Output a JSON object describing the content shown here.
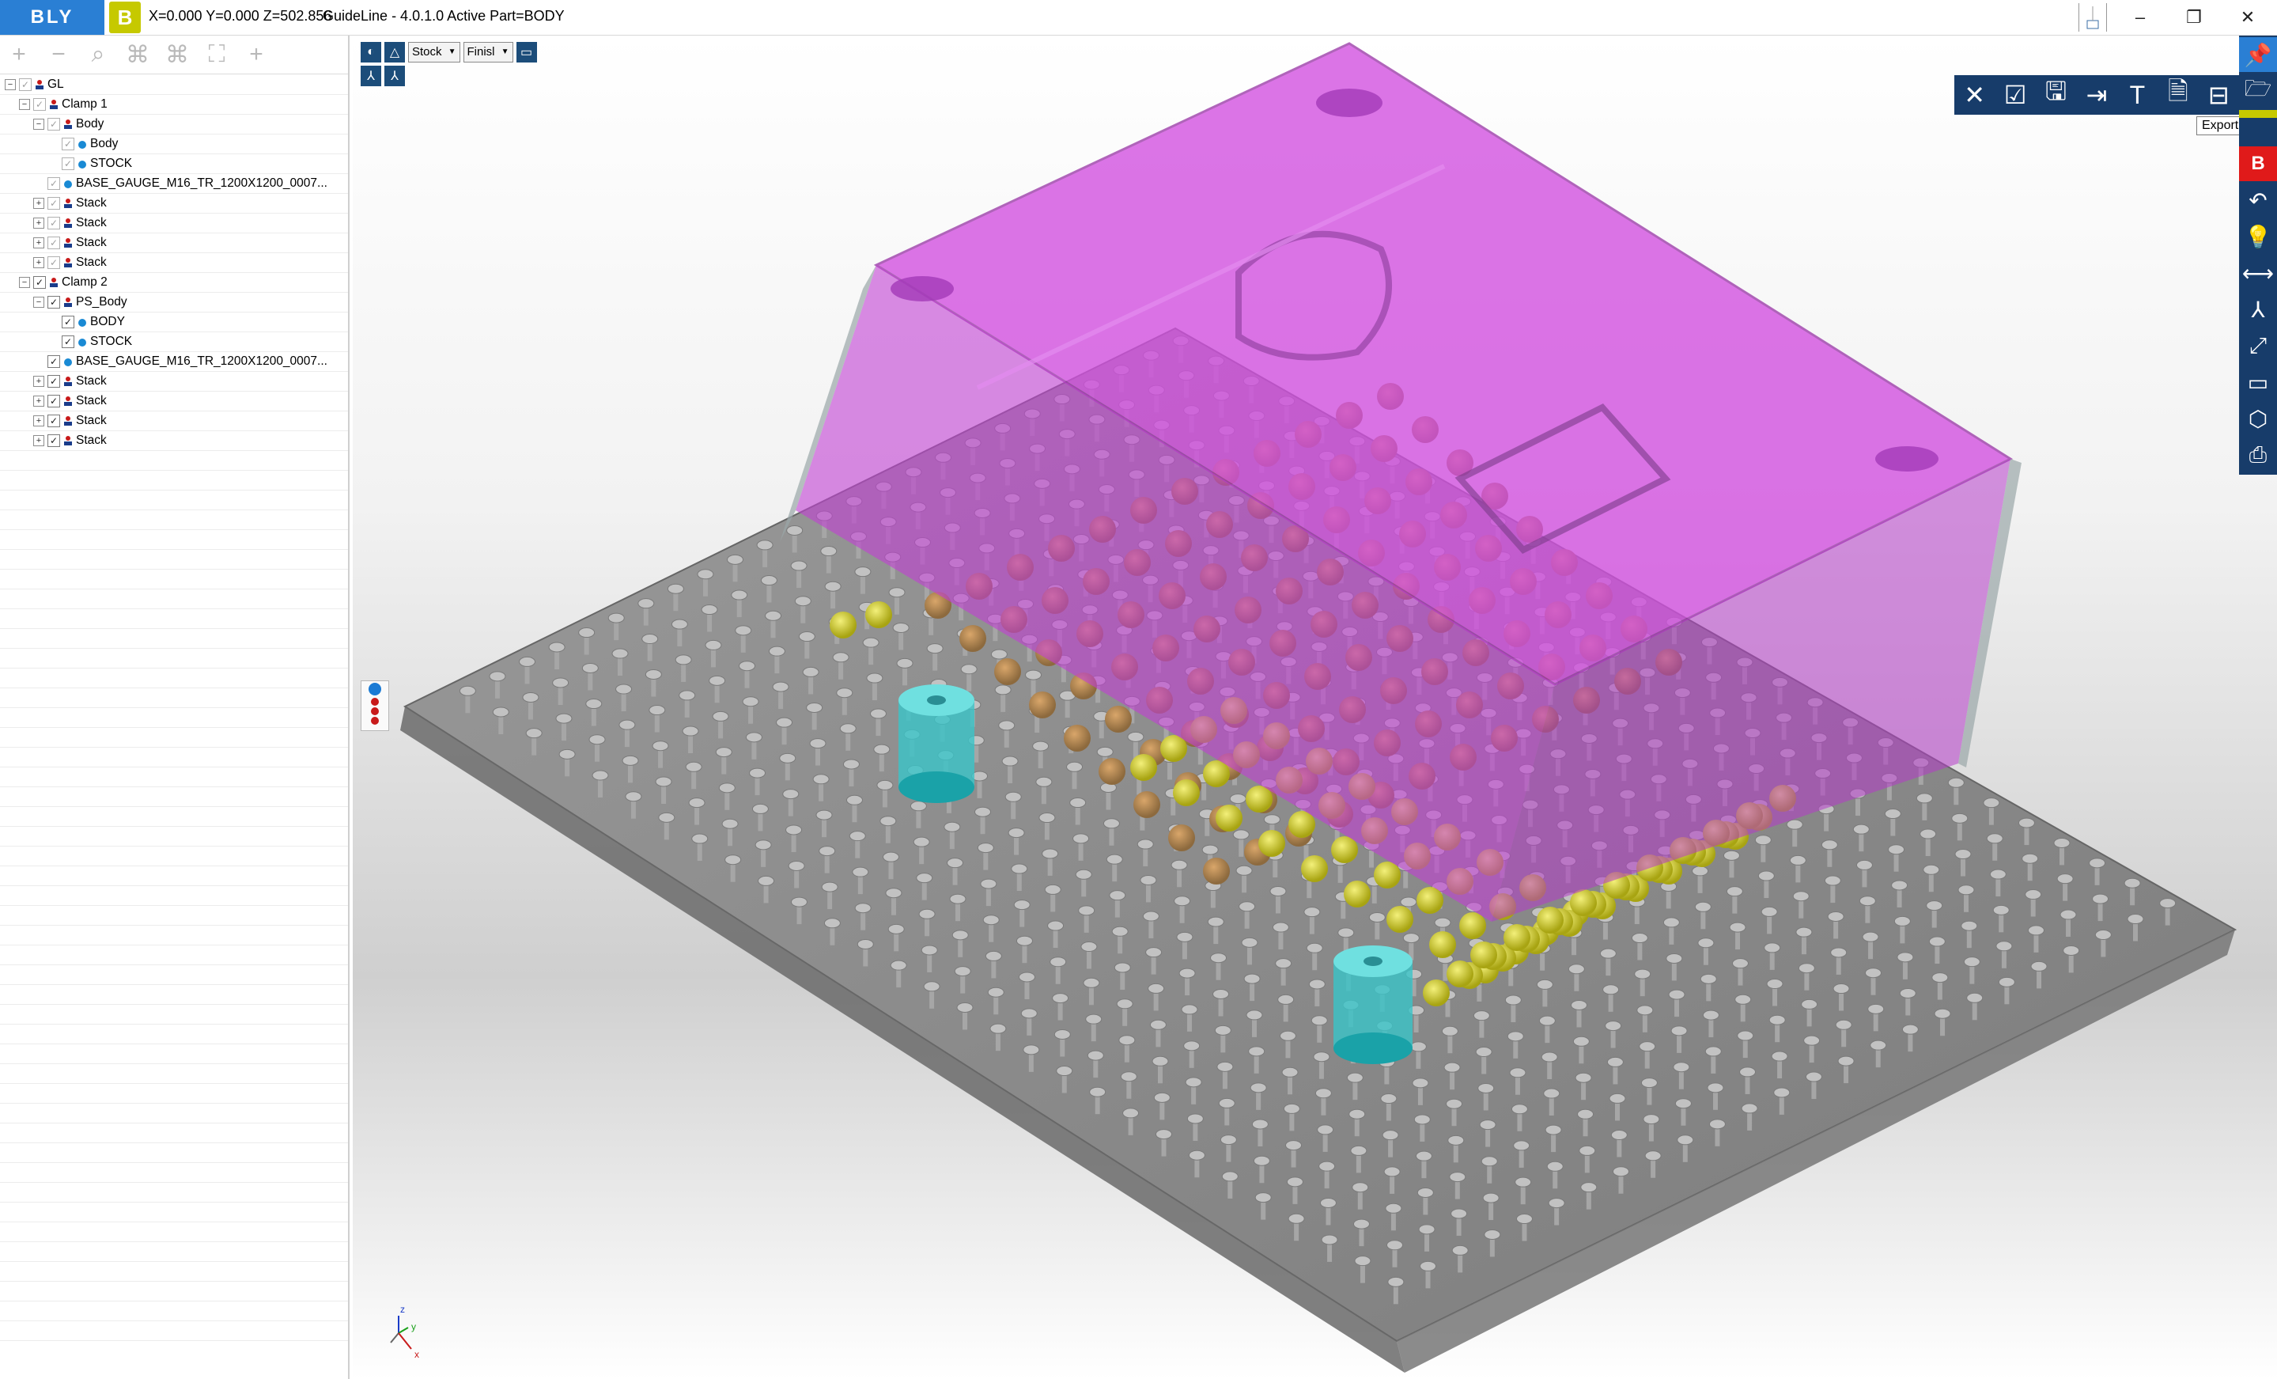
{
  "app": {
    "logo_text": "BLY",
    "logo_b": "B",
    "coords": "X=0.000 Y=0.000 Z=502.856",
    "title": "GuideLine - 4.0.1.0 Active Part=BODY",
    "window_controls": {
      "minimize": "–",
      "restore": "❐",
      "close": "✕"
    }
  },
  "tree_toolbar": [
    {
      "name": "expand-icon",
      "glyph": "+"
    },
    {
      "name": "collapse-icon",
      "glyph": "−"
    },
    {
      "name": "search-icon",
      "glyph": "⌕"
    },
    {
      "name": "tree-add-icon",
      "glyph": "⌘"
    },
    {
      "name": "tree-remove-icon",
      "glyph": "⌘"
    },
    {
      "name": "fit-icon",
      "glyph": "⛶"
    },
    {
      "name": "plus-icon",
      "glyph": "+"
    }
  ],
  "tree": {
    "rows": [
      {
        "label": "GL",
        "level": 0,
        "expander": "−",
        "checked": true,
        "dim": true,
        "icon": "assembly"
      },
      {
        "label": "Clamp 1",
        "level": 1,
        "expander": "−",
        "checked": true,
        "dim": true,
        "icon": "assembly"
      },
      {
        "label": "Body",
        "level": 2,
        "expander": "−",
        "checked": true,
        "dim": true,
        "icon": "assembly"
      },
      {
        "label": "Body",
        "level": 3,
        "expander": "",
        "checked": true,
        "dim": true,
        "icon": "part"
      },
      {
        "label": "STOCK",
        "level": 3,
        "expander": "",
        "checked": true,
        "dim": true,
        "icon": "part"
      },
      {
        "label": "BASE_GAUGE_M16_TR_1200X1200_0007...",
        "level": 2,
        "expander": "",
        "checked": true,
        "dim": true,
        "icon": "part"
      },
      {
        "label": "Stack",
        "level": 2,
        "expander": "+",
        "checked": true,
        "dim": true,
        "icon": "assembly"
      },
      {
        "label": "Stack",
        "level": 2,
        "expander": "+",
        "checked": true,
        "dim": true,
        "icon": "assembly"
      },
      {
        "label": "Stack",
        "level": 2,
        "expander": "+",
        "checked": true,
        "dim": true,
        "icon": "assembly"
      },
      {
        "label": "Stack",
        "level": 2,
        "expander": "+",
        "checked": true,
        "dim": true,
        "icon": "assembly"
      },
      {
        "label": "Clamp 2",
        "level": 1,
        "expander": "−",
        "checked": true,
        "dim": false,
        "icon": "assembly"
      },
      {
        "label": "PS_Body",
        "level": 2,
        "expander": "−",
        "checked": true,
        "dim": false,
        "icon": "assembly"
      },
      {
        "label": "BODY",
        "level": 3,
        "expander": "",
        "checked": true,
        "dim": false,
        "icon": "part"
      },
      {
        "label": "STOCK",
        "level": 3,
        "expander": "",
        "checked": true,
        "dim": false,
        "icon": "part"
      },
      {
        "label": "BASE_GAUGE_M16_TR_1200X1200_0007...",
        "level": 2,
        "expander": "",
        "checked": true,
        "dim": false,
        "icon": "part"
      },
      {
        "label": "Stack",
        "level": 2,
        "expander": "+",
        "checked": true,
        "dim": false,
        "icon": "assembly"
      },
      {
        "label": "Stack",
        "level": 2,
        "expander": "+",
        "checked": true,
        "dim": false,
        "icon": "assembly"
      },
      {
        "label": "Stack",
        "level": 2,
        "expander": "+",
        "checked": true,
        "dim": false,
        "icon": "assembly"
      },
      {
        "label": "Stack",
        "level": 2,
        "expander": "+",
        "checked": true,
        "dim": false,
        "icon": "assembly"
      }
    ]
  },
  "viewport": {
    "view_mode_select": "Stock",
    "finish_select": "Finisl",
    "tooltip": "Export BCK",
    "axis_labels": {
      "x": "x",
      "y": "y",
      "z": "z"
    },
    "colors": {
      "stock": "#d24ee0",
      "plate": "#8a8a8a",
      "bolt": "#b0b0b0",
      "support": "#d8d41e",
      "cylinder": "#2cc4c4",
      "strip": "#173c6a"
    }
  },
  "export_bar": [
    {
      "name": "close-icon",
      "glyph": "✕"
    },
    {
      "name": "check-icon",
      "glyph": "☑"
    },
    {
      "name": "save-icon",
      "glyph": "🖫"
    },
    {
      "name": "export-icon",
      "glyph": "⇥"
    },
    {
      "name": "text-icon",
      "glyph": "T"
    },
    {
      "name": "pdf-icon",
      "glyph": "🗎"
    },
    {
      "name": "export-bck-icon",
      "glyph": "⊟"
    }
  ],
  "right_strip": [
    {
      "name": "pin-icon",
      "glyph": "📌"
    },
    {
      "name": "open-folder-icon",
      "glyph": "🗁"
    },
    {
      "name": "bly-b-icon",
      "glyph": "B"
    },
    {
      "name": "undo-icon",
      "glyph": "↶"
    },
    {
      "name": "lightbulb-icon",
      "glyph": "💡"
    },
    {
      "name": "measure-icon",
      "glyph": "⟷"
    },
    {
      "name": "axes-icon",
      "glyph": "⅄"
    },
    {
      "name": "fit-view-icon",
      "glyph": "⤢"
    },
    {
      "name": "window-icon",
      "glyph": "▭"
    },
    {
      "name": "cube-view-icon",
      "glyph": "⬡"
    },
    {
      "name": "print-icon",
      "glyph": "⎙"
    }
  ]
}
